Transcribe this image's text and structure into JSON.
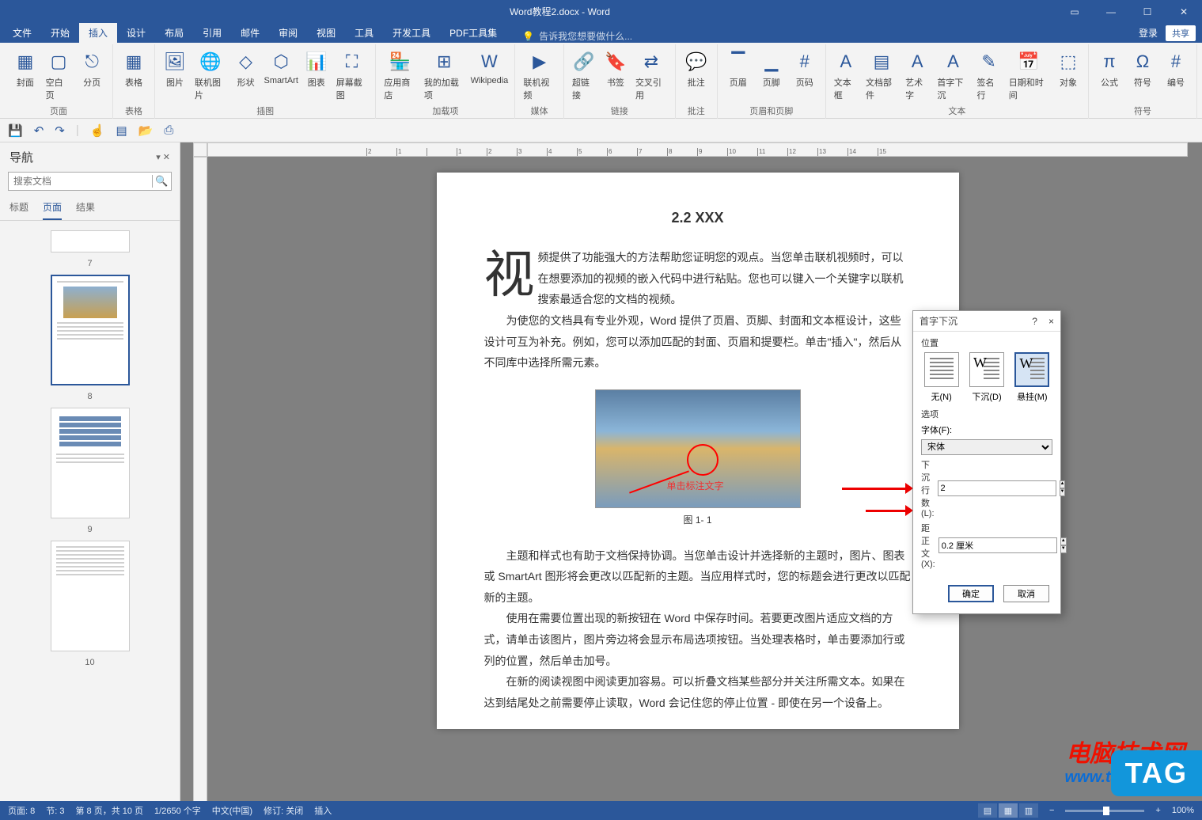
{
  "titlebar": {
    "filename": "Word教程2.docx - Word"
  },
  "window_controls": {
    "login": "登录",
    "share": "共享"
  },
  "tabs": [
    "文件",
    "开始",
    "插入",
    "设计",
    "布局",
    "引用",
    "邮件",
    "审阅",
    "视图",
    "工具",
    "开发工具",
    "PDF工具集"
  ],
  "active_tab_index": 2,
  "tell_me": "告诉我您想要做什么...",
  "ribbon_groups": [
    {
      "label": "页面",
      "items": [
        "封面",
        "空白页",
        "分页"
      ]
    },
    {
      "label": "表格",
      "items": [
        "表格"
      ]
    },
    {
      "label": "插图",
      "items": [
        "图片",
        "联机图片",
        "形状",
        "SmartArt",
        "图表",
        "屏幕截图"
      ]
    },
    {
      "label": "加载项",
      "items": [
        "应用商店",
        "我的加载项",
        "Wikipedia"
      ]
    },
    {
      "label": "媒体",
      "items": [
        "联机视频"
      ]
    },
    {
      "label": "链接",
      "items": [
        "超链接",
        "书签",
        "交叉引用"
      ]
    },
    {
      "label": "批注",
      "items": [
        "批注"
      ]
    },
    {
      "label": "页眉和页脚",
      "items": [
        "页眉",
        "页脚",
        "页码"
      ]
    },
    {
      "label": "文本",
      "items": [
        "文本框",
        "文档部件",
        "艺术字",
        "首字下沉",
        "签名行",
        "日期和时间",
        "对象"
      ]
    },
    {
      "label": "符号",
      "items": [
        "公式",
        "符号",
        "编号"
      ]
    }
  ],
  "nav": {
    "title": "导航",
    "search_placeholder": "搜索文档",
    "tabs": [
      "标题",
      "页面",
      "结果"
    ],
    "active_nav_tab": 1,
    "page_numbers": [
      "7",
      "8",
      "9",
      "10"
    ]
  },
  "document": {
    "title": "2.2 XXX",
    "dropcap": "视",
    "p1": "频提供了功能强大的方法帮助您证明您的观点。当您单击联机视频时，可以在想要添加的视频的嵌入代码中进行粘贴。您也可以键入一个关键字以联机搜索最适合您的文档的视频。",
    "p2": "为使您的文档具有专业外观，Word 提供了页眉、页脚、封面和文本框设计，这些设计可互为补充。例如，您可以添加匹配的封面、页眉和提要栏。单击\"插入\"，然后从不同库中选择所需元素。",
    "caption": "图 1- 1",
    "figtext": "单击标注文字",
    "p3": "主题和样式也有助于文档保持协调。当您单击设计并选择新的主题时，图片、图表或 SmartArt 图形将会更改以匹配新的主题。当应用样式时，您的标题会进行更改以匹配新的主题。",
    "p4": "使用在需要位置出现的新按钮在 Word 中保存时间。若要更改图片适应文档的方式，请单击该图片，图片旁边将会显示布局选项按钮。当处理表格时，单击要添加行或列的位置，然后单击加号。",
    "p5": "在新的阅读视图中阅读更加容易。可以折叠文档某些部分并关注所需文本。如果在达到结尾处之前需要停止读取，Word 会记住您的停止位置 - 即使在另一个设备上。"
  },
  "dialog": {
    "title": "首字下沉",
    "help": "?",
    "close": "×",
    "position_label": "位置",
    "options": [
      {
        "label": "无(N)"
      },
      {
        "label": "下沉(D)"
      },
      {
        "label": "悬挂(M)"
      }
    ],
    "options_section": "选项",
    "font_label": "字体(F):",
    "font_value": "宋体",
    "lines_label": "下沉行数(L):",
    "lines_value": "2",
    "distance_label": "距正文(X):",
    "distance_value": "0.2 厘米",
    "ok": "确定",
    "cancel": "取消"
  },
  "statusbar": {
    "page": "页面: 8",
    "section": "节: 3",
    "page_of": "第 8 页，共 10 页",
    "words": "1/2650 个字",
    "lang": "中文(中国)",
    "track": "修订: 关闭",
    "mode": "插入",
    "zoom": "100%"
  },
  "watermark": {
    "line1": "电脑技术网",
    "line2": "www.tagxp.com",
    "badge": "TAG"
  }
}
